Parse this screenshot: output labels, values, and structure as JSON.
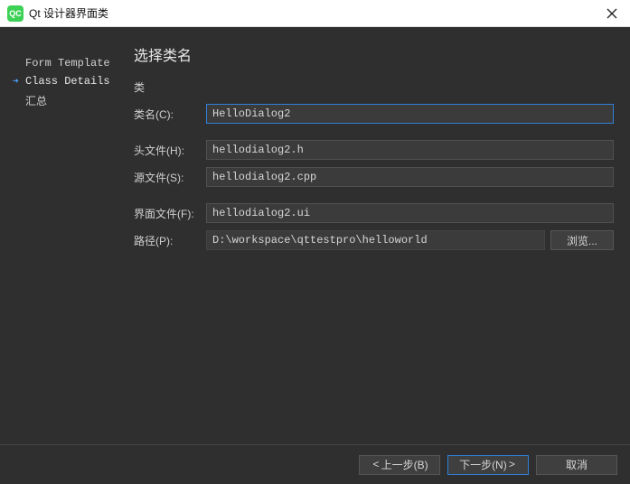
{
  "titlebar": {
    "icon_text": "QC",
    "title": "Qt 设计器界面类"
  },
  "sidebar": {
    "items": [
      {
        "label": "Form Template",
        "active": false
      },
      {
        "label": "Class Details",
        "active": true
      },
      {
        "label": "汇总",
        "active": false
      }
    ]
  },
  "main": {
    "heading": "选择类名",
    "section_label": "类",
    "fields": {
      "class_name_label": "类名(C):",
      "class_name_value": "HelloDialog2",
      "header_label": "头文件(H):",
      "header_value": "hellodialog2.h",
      "source_label": "源文件(S):",
      "source_value": "hellodialog2.cpp",
      "form_label": "界面文件(F):",
      "form_value": "hellodialog2.ui",
      "path_label": "路径(P):",
      "path_value": "D:\\workspace\\qttestpro\\helloworld",
      "browse_label": "浏览..."
    }
  },
  "buttons": {
    "back_prefix": "<",
    "back_label": "上一步(B)",
    "next_label": "下一步(N)",
    "next_suffix": ">",
    "cancel_label": "取消"
  }
}
